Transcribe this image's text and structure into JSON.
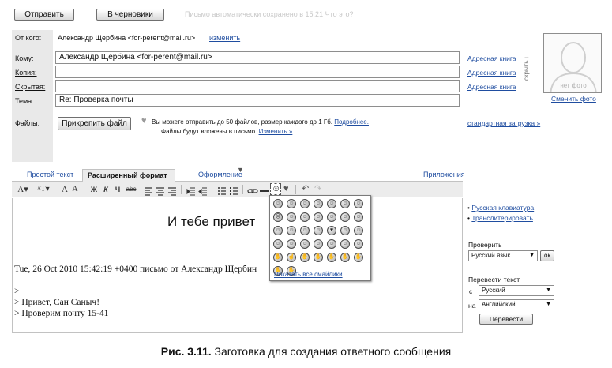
{
  "top_bar": {
    "send_label": "Отправить",
    "drafts_label": "В черновики",
    "autosave_text": "Письмо автоматически сохранено в 15:21 Что это?"
  },
  "header": {
    "from_label": "От кого:",
    "from_value": "Александр Щербина <for-perent@mail.ru>",
    "from_change_link": "изменить",
    "to_label": "Кому:",
    "to_value": "Александр Щербина <for-perent@mail.ru>",
    "cc_label": "Копия:",
    "cc_value": "",
    "bcc_label": "Скрытая:",
    "bcc_value": "",
    "subject_label": "Тема:",
    "subject_value": "Re: Проверка почты",
    "address_book_label": "Адресная книга"
  },
  "files": {
    "label": "Файлы:",
    "attach_button": "Прикрепить файл",
    "info_line1": "Вы можете отправить до 50 файлов, размер каждого до 1 Гб.",
    "info_details_link": "Подробнее.",
    "info_line2": "Файлы будут вложены в письмо.",
    "info_change_link": "Изменить »",
    "standard_upload_link": "стандартная загрузка »"
  },
  "photo": {
    "placeholder_text": "нет фото",
    "hide_text": "скрыть ↓",
    "change_photo_link": "Сменить фото"
  },
  "editor_tabs": {
    "plain_text": "Простой текст",
    "rich_format": "Расширенный формат",
    "design": "Оформление",
    "attachments": "Приложения"
  },
  "toolbar": {
    "font": "A▾",
    "font_size": "ᴬT▾",
    "bigger": "A",
    "smaller": "A",
    "bold": "Ж",
    "italic": "К",
    "underline": "Ч",
    "strike": "abc"
  },
  "body": {
    "heading": "И тебе привет",
    "quote_header": "Tue, 26 Oct 2010 15:42:19 +0400 письмо от Александр Щербин",
    "quote_mark": ">",
    "line1": "> Привет, Сан Саныч!",
    "line2": "> Проверим почту 15-41"
  },
  "smiley_popup": {
    "show_all_link": "Показать все смайлики",
    "smileys": [
      "☺",
      "☺",
      "☺",
      "☺",
      "☺",
      "☺",
      "☺",
      "☹",
      "☺",
      "☺",
      "☺",
      "☺",
      "☺",
      "☺",
      "☺",
      "☺",
      "☺",
      "☺",
      "♥",
      "☺",
      "☺",
      "☺",
      "☺",
      "☺",
      "☺",
      "☺",
      "☺",
      "☺",
      "✋",
      "✌",
      "✋",
      "✋",
      "✋",
      "✋",
      "✋",
      "✋",
      "✋"
    ]
  },
  "sidebar": {
    "russian_keyboard_link": "Русская клавиатура",
    "transliterate_link": "Транслитерировать",
    "check_label": "Проверить",
    "check_lang": "Русский язык",
    "ok_label": "ок",
    "translate_label": "Перевести текст",
    "from_prefix": "с",
    "from_lang": "Русский",
    "to_prefix": "на",
    "to_lang": "Английский",
    "translate_button": "Перевести"
  },
  "caption": {
    "prefix": "Рис. 3.11.",
    "text": "Заготовка для создания ответного сообщения"
  }
}
